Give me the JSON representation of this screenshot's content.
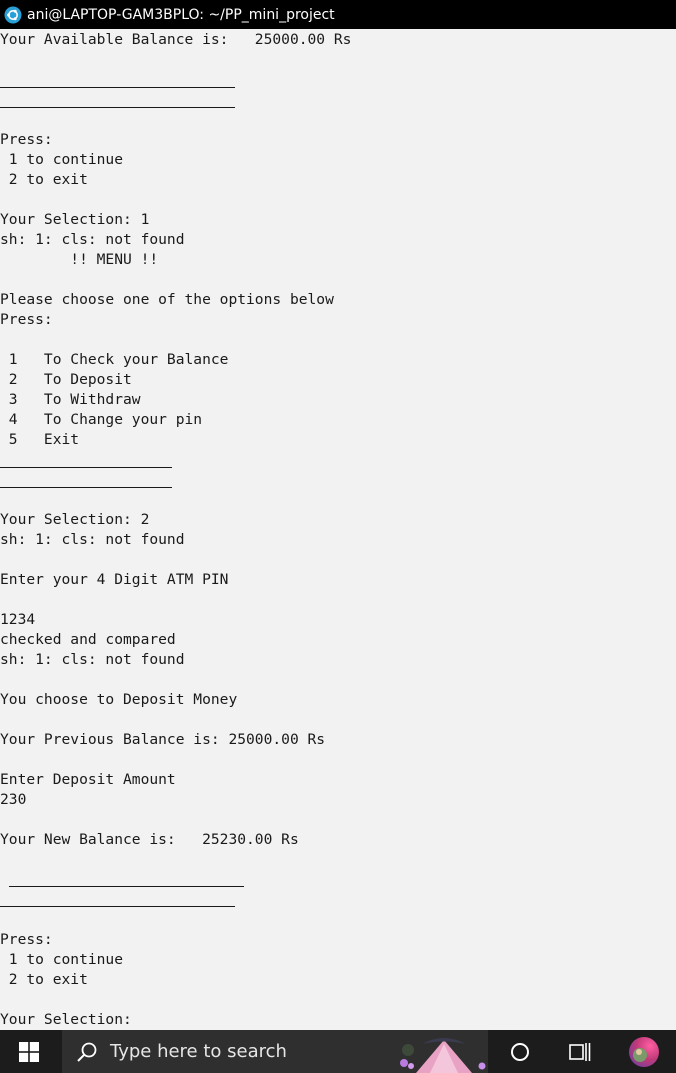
{
  "titlebar": {
    "title": "ani@LAPTOP-GAM3BPLO: ~/PP_mini_project"
  },
  "terminal": {
    "lines": [
      "Your Available Balance is:   25000.00 Rs",
      "",
      "",
      "",
      "",
      "Press:",
      " 1 to continue",
      " 2 to exit",
      "",
      "Your Selection: 1",
      "sh: 1: cls: not found",
      "        !! MENU !!",
      "",
      "Please choose one of the options below",
      "Press:",
      "",
      " 1   To Check your Balance",
      " 2   To Deposit",
      " 3   To Withdraw",
      " 4   To Change your pin",
      " 5   Exit",
      "",
      "",
      "",
      "Your Selection: 2",
      "sh: 1: cls: not found",
      "",
      "Enter your 4 Digit ATM PIN",
      "",
      "1234",
      "checked and compared",
      "sh: 1: cls: not found",
      "",
      "You choose to Deposit Money",
      "",
      "Your Previous Balance is: 25000.00 Rs",
      "",
      "Enter Deposit Amount",
      "230",
      "",
      "Your New Balance is:   25230.00 Rs",
      "",
      "",
      "",
      "",
      "Press:",
      " 1 to continue",
      " 2 to exit",
      "",
      "Your Selection:"
    ]
  },
  "taskbar": {
    "search_placeholder": "Type here to search",
    "icons": [
      "windows-start-icon",
      "search-icon",
      "cortana-icon",
      "task-view-icon",
      "user-avatar-icon"
    ]
  },
  "colors": {
    "terminal_bg": "#f2f2f2",
    "terminal_text": "#1a1a1a",
    "titlebar_bg": "#000000",
    "taskbar_bg": "#1c1c1c",
    "searchbox_bg": "#2f2f2f"
  }
}
